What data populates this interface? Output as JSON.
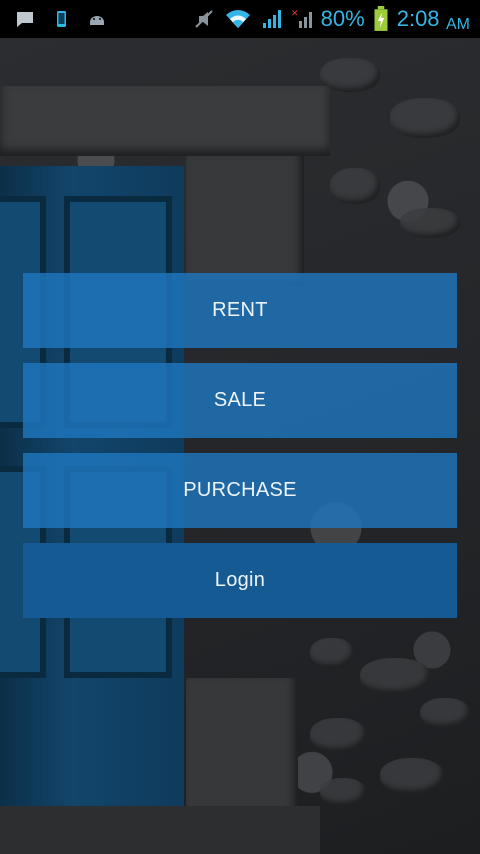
{
  "status_bar": {
    "battery_percent": "80%",
    "time": "2:08",
    "ampm": "AM",
    "icons": [
      "message-icon",
      "phone-icon",
      "android-icon",
      "mute-icon",
      "wifi-icon",
      "signal-icon",
      "signal-no-data-icon",
      "battery-charging-icon"
    ],
    "accent_color": "#33b5e5"
  },
  "menu": {
    "rent_label": "RENT",
    "sale_label": "SALE",
    "purchase_label": "PURCHASE",
    "login_label": "Login"
  },
  "colors": {
    "button_bg": "#1e76be",
    "login_bg": "#155a92",
    "button_text": "#eef4fa"
  }
}
